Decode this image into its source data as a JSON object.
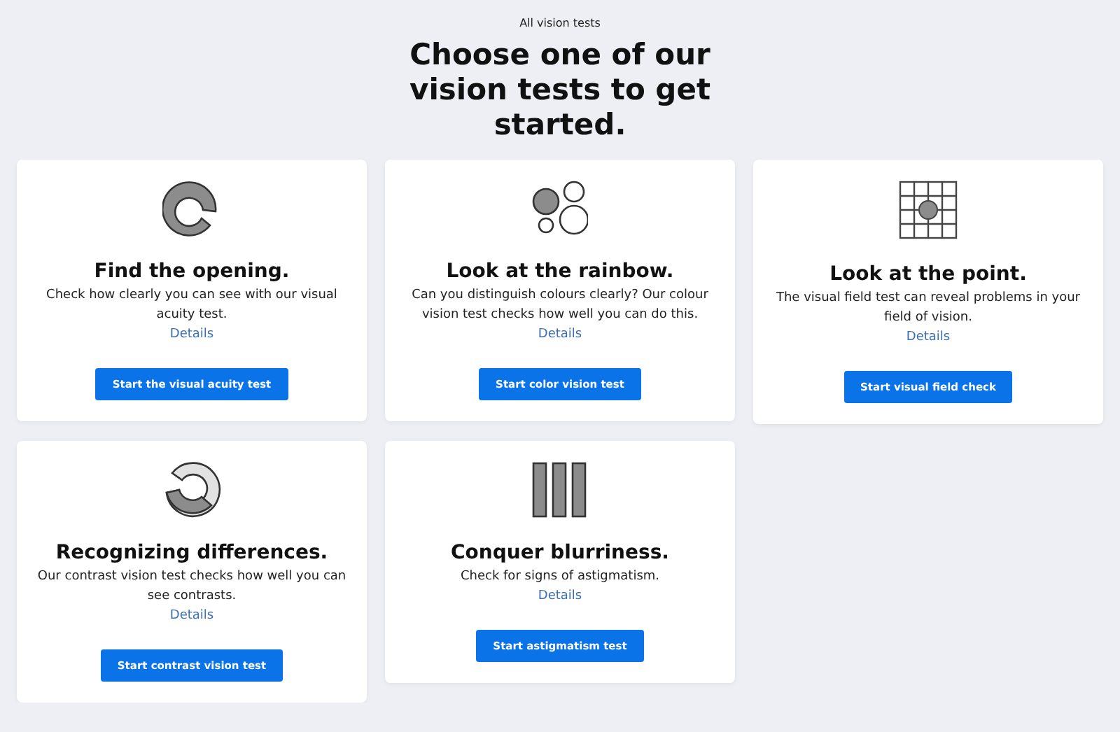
{
  "breadcrumb": "All vision tests",
  "heading": "Choose one of our vision tests to get started.",
  "tests": [
    {
      "kind": "ring",
      "title": "Find the opening.",
      "description": "Check how clearly you can see with our visual acuity test.",
      "link": "Details",
      "button": "Start the visual acuity test"
    },
    {
      "kind": "bubbles",
      "title": "Look at the rainbow.",
      "description": "Can you distinguish colours clearly? Our colour vision test checks how well you can do this.",
      "link": "Details",
      "button": "Start color vision test"
    },
    {
      "kind": "grid",
      "title": "Look at the point.",
      "description": "The visual field test can reveal problems in your field of vision.",
      "link": "Details",
      "button": "Start visual field check"
    },
    {
      "kind": "contrast",
      "title": "Recognizing differences.",
      "description": "Our contrast vision test checks how well you can see contrasts.",
      "link": "Details",
      "button": "Start contrast vision test"
    },
    {
      "kind": "bars",
      "title": "Conquer blurriness.",
      "description": "Check for signs of astigmatism.",
      "link": "Details",
      "button": "Start astigmatism test"
    }
  ]
}
